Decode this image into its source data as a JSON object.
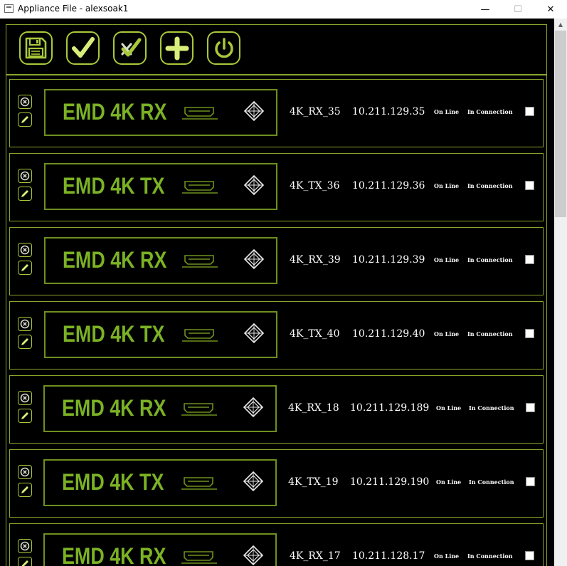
{
  "window": {
    "title": "Appliance File - alexsoak1",
    "minimize_glyph": "—",
    "maximize_glyph": "☐",
    "close_glyph": "✕"
  },
  "toolbar": {
    "buttons": [
      {
        "name": "save",
        "icon": "floppy-disk-icon"
      },
      {
        "name": "check",
        "icon": "check-icon"
      },
      {
        "name": "check-all",
        "icon": "check-x-icon"
      },
      {
        "name": "add",
        "icon": "plus-icon"
      },
      {
        "name": "power",
        "icon": "power-icon"
      }
    ]
  },
  "colors": {
    "accent": "#a9c93a",
    "model_text": "#7bb224",
    "border": "#8aa52b",
    "background": "#000000"
  },
  "devices": [
    {
      "model": "EMD 4K RX",
      "name": "4K_RX_35",
      "ip": "10.211.129.35",
      "status": "On Line",
      "connection": "In Connection",
      "checked": false
    },
    {
      "model": "EMD 4K TX",
      "name": "4K_TX_36",
      "ip": "10.211.129.36",
      "status": "On Line",
      "connection": "In Connection",
      "checked": false
    },
    {
      "model": "EMD 4K RX",
      "name": "4K_RX_39",
      "ip": "10.211.129.39",
      "status": "On Line",
      "connection": "In Connection",
      "checked": false
    },
    {
      "model": "EMD 4K TX",
      "name": "4K_TX_40",
      "ip": "10.211.129.40",
      "status": "On Line",
      "connection": "In Connection",
      "checked": false
    },
    {
      "model": "EMD 4K RX",
      "name": "4K_RX_18",
      "ip": "10.211.129.189",
      "status": "On Line",
      "connection": "In Connection",
      "checked": false
    },
    {
      "model": "EMD 4K TX",
      "name": "4K_TX_19",
      "ip": "10.211.129.190",
      "status": "On Line",
      "connection": "In Connection",
      "checked": false
    },
    {
      "model": "EMD 4K RX",
      "name": "4K_RX_17",
      "ip": "10.211.128.17",
      "status": "On Line",
      "connection": "In Connection",
      "checked": false
    }
  ]
}
